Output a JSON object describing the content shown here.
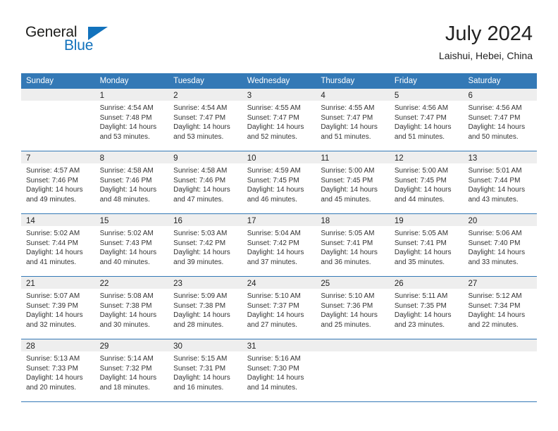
{
  "logo": {
    "word1": "General",
    "word2": "Blue",
    "triangle_color": "#1272bc",
    "word1_color": "#1d1d1b",
    "word2_color": "#1272bc"
  },
  "header": {
    "title": "July 2024",
    "location": "Laishui, Hebei, China"
  },
  "colors": {
    "header_blue": "#3479b6",
    "date_band": "#eeeeee",
    "text": "#333333"
  },
  "weekdays": [
    "Sunday",
    "Monday",
    "Tuesday",
    "Wednesday",
    "Thursday",
    "Friday",
    "Saturday"
  ],
  "weeks": [
    [
      {
        "day": "",
        "lines": []
      },
      {
        "day": "1",
        "lines": [
          "Sunrise: 4:54 AM",
          "Sunset: 7:48 PM",
          "Daylight: 14 hours",
          "and 53 minutes."
        ]
      },
      {
        "day": "2",
        "lines": [
          "Sunrise: 4:54 AM",
          "Sunset: 7:47 PM",
          "Daylight: 14 hours",
          "and 53 minutes."
        ]
      },
      {
        "day": "3",
        "lines": [
          "Sunrise: 4:55 AM",
          "Sunset: 7:47 PM",
          "Daylight: 14 hours",
          "and 52 minutes."
        ]
      },
      {
        "day": "4",
        "lines": [
          "Sunrise: 4:55 AM",
          "Sunset: 7:47 PM",
          "Daylight: 14 hours",
          "and 51 minutes."
        ]
      },
      {
        "day": "5",
        "lines": [
          "Sunrise: 4:56 AM",
          "Sunset: 7:47 PM",
          "Daylight: 14 hours",
          "and 51 minutes."
        ]
      },
      {
        "day": "6",
        "lines": [
          "Sunrise: 4:56 AM",
          "Sunset: 7:47 PM",
          "Daylight: 14 hours",
          "and 50 minutes."
        ]
      }
    ],
    [
      {
        "day": "7",
        "lines": [
          "Sunrise: 4:57 AM",
          "Sunset: 7:46 PM",
          "Daylight: 14 hours",
          "and 49 minutes."
        ]
      },
      {
        "day": "8",
        "lines": [
          "Sunrise: 4:58 AM",
          "Sunset: 7:46 PM",
          "Daylight: 14 hours",
          "and 48 minutes."
        ]
      },
      {
        "day": "9",
        "lines": [
          "Sunrise: 4:58 AM",
          "Sunset: 7:46 PM",
          "Daylight: 14 hours",
          "and 47 minutes."
        ]
      },
      {
        "day": "10",
        "lines": [
          "Sunrise: 4:59 AM",
          "Sunset: 7:45 PM",
          "Daylight: 14 hours",
          "and 46 minutes."
        ]
      },
      {
        "day": "11",
        "lines": [
          "Sunrise: 5:00 AM",
          "Sunset: 7:45 PM",
          "Daylight: 14 hours",
          "and 45 minutes."
        ]
      },
      {
        "day": "12",
        "lines": [
          "Sunrise: 5:00 AM",
          "Sunset: 7:45 PM",
          "Daylight: 14 hours",
          "and 44 minutes."
        ]
      },
      {
        "day": "13",
        "lines": [
          "Sunrise: 5:01 AM",
          "Sunset: 7:44 PM",
          "Daylight: 14 hours",
          "and 43 minutes."
        ]
      }
    ],
    [
      {
        "day": "14",
        "lines": [
          "Sunrise: 5:02 AM",
          "Sunset: 7:44 PM",
          "Daylight: 14 hours",
          "and 41 minutes."
        ]
      },
      {
        "day": "15",
        "lines": [
          "Sunrise: 5:02 AM",
          "Sunset: 7:43 PM",
          "Daylight: 14 hours",
          "and 40 minutes."
        ]
      },
      {
        "day": "16",
        "lines": [
          "Sunrise: 5:03 AM",
          "Sunset: 7:42 PM",
          "Daylight: 14 hours",
          "and 39 minutes."
        ]
      },
      {
        "day": "17",
        "lines": [
          "Sunrise: 5:04 AM",
          "Sunset: 7:42 PM",
          "Daylight: 14 hours",
          "and 37 minutes."
        ]
      },
      {
        "day": "18",
        "lines": [
          "Sunrise: 5:05 AM",
          "Sunset: 7:41 PM",
          "Daylight: 14 hours",
          "and 36 minutes."
        ]
      },
      {
        "day": "19",
        "lines": [
          "Sunrise: 5:05 AM",
          "Sunset: 7:41 PM",
          "Daylight: 14 hours",
          "and 35 minutes."
        ]
      },
      {
        "day": "20",
        "lines": [
          "Sunrise: 5:06 AM",
          "Sunset: 7:40 PM",
          "Daylight: 14 hours",
          "and 33 minutes."
        ]
      }
    ],
    [
      {
        "day": "21",
        "lines": [
          "Sunrise: 5:07 AM",
          "Sunset: 7:39 PM",
          "Daylight: 14 hours",
          "and 32 minutes."
        ]
      },
      {
        "day": "22",
        "lines": [
          "Sunrise: 5:08 AM",
          "Sunset: 7:38 PM",
          "Daylight: 14 hours",
          "and 30 minutes."
        ]
      },
      {
        "day": "23",
        "lines": [
          "Sunrise: 5:09 AM",
          "Sunset: 7:38 PM",
          "Daylight: 14 hours",
          "and 28 minutes."
        ]
      },
      {
        "day": "24",
        "lines": [
          "Sunrise: 5:10 AM",
          "Sunset: 7:37 PM",
          "Daylight: 14 hours",
          "and 27 minutes."
        ]
      },
      {
        "day": "25",
        "lines": [
          "Sunrise: 5:10 AM",
          "Sunset: 7:36 PM",
          "Daylight: 14 hours",
          "and 25 minutes."
        ]
      },
      {
        "day": "26",
        "lines": [
          "Sunrise: 5:11 AM",
          "Sunset: 7:35 PM",
          "Daylight: 14 hours",
          "and 23 minutes."
        ]
      },
      {
        "day": "27",
        "lines": [
          "Sunrise: 5:12 AM",
          "Sunset: 7:34 PM",
          "Daylight: 14 hours",
          "and 22 minutes."
        ]
      }
    ],
    [
      {
        "day": "28",
        "lines": [
          "Sunrise: 5:13 AM",
          "Sunset: 7:33 PM",
          "Daylight: 14 hours",
          "and 20 minutes."
        ]
      },
      {
        "day": "29",
        "lines": [
          "Sunrise: 5:14 AM",
          "Sunset: 7:32 PM",
          "Daylight: 14 hours",
          "and 18 minutes."
        ]
      },
      {
        "day": "30",
        "lines": [
          "Sunrise: 5:15 AM",
          "Sunset: 7:31 PM",
          "Daylight: 14 hours",
          "and 16 minutes."
        ]
      },
      {
        "day": "31",
        "lines": [
          "Sunrise: 5:16 AM",
          "Sunset: 7:30 PM",
          "Daylight: 14 hours",
          "and 14 minutes."
        ]
      },
      {
        "day": "",
        "lines": []
      },
      {
        "day": "",
        "lines": []
      },
      {
        "day": "",
        "lines": []
      }
    ]
  ]
}
